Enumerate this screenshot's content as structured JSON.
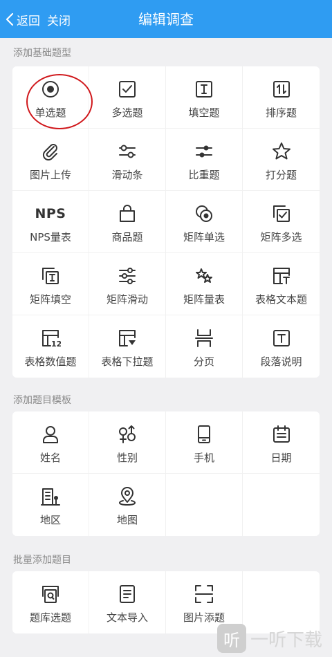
{
  "header": {
    "back_label": "返回",
    "close_label": "关闭",
    "title": "编辑调查"
  },
  "sections": [
    {
      "title": "添加基础题型",
      "items": [
        {
          "label": "单选题",
          "icon": "radio-icon"
        },
        {
          "label": "多选题",
          "icon": "checkbox-icon"
        },
        {
          "label": "填空题",
          "icon": "text-input-icon"
        },
        {
          "label": "排序题",
          "icon": "sort-icon"
        },
        {
          "label": "图片上传",
          "icon": "paperclip-icon"
        },
        {
          "label": "滑动条",
          "icon": "slider-icon"
        },
        {
          "label": "比重题",
          "icon": "weight-slider-icon"
        },
        {
          "label": "打分题",
          "icon": "star-icon"
        },
        {
          "label": "NPS量表",
          "icon": "nps-icon",
          "icon_text": "NPS"
        },
        {
          "label": "商品题",
          "icon": "shopping-bag-icon"
        },
        {
          "label": "矩阵单选",
          "icon": "matrix-radio-icon"
        },
        {
          "label": "矩阵多选",
          "icon": "matrix-checkbox-icon"
        },
        {
          "label": "矩阵填空",
          "icon": "matrix-text-icon"
        },
        {
          "label": "矩阵滑动",
          "icon": "matrix-slider-icon"
        },
        {
          "label": "矩阵量表",
          "icon": "matrix-scale-icon"
        },
        {
          "label": "表格文本题",
          "icon": "table-text-icon"
        },
        {
          "label": "表格数值题",
          "icon": "table-number-icon"
        },
        {
          "label": "表格下拉题",
          "icon": "table-dropdown-icon"
        },
        {
          "label": "分页",
          "icon": "page-break-icon"
        },
        {
          "label": "段落说明",
          "icon": "paragraph-icon"
        }
      ]
    },
    {
      "title": "添加题目模板",
      "items": [
        {
          "label": "姓名",
          "icon": "person-icon"
        },
        {
          "label": "性别",
          "icon": "gender-icon"
        },
        {
          "label": "手机",
          "icon": "mobile-phone-icon"
        },
        {
          "label": "日期",
          "icon": "calendar-icon"
        },
        {
          "label": "地区",
          "icon": "building-icon"
        },
        {
          "label": "地图",
          "icon": "map-pin-icon"
        }
      ]
    },
    {
      "title": "批量添加题目",
      "items": [
        {
          "label": "题库选题",
          "icon": "question-bank-icon"
        },
        {
          "label": "文本导入",
          "icon": "document-import-icon"
        },
        {
          "label": "图片添题",
          "icon": "scan-image-icon"
        }
      ]
    }
  ],
  "watermark": {
    "badge": "听",
    "text": "一听下载"
  },
  "colors": {
    "topbar": "#2f9cf2",
    "highlight": "#d0181c",
    "icon": "#333333"
  }
}
